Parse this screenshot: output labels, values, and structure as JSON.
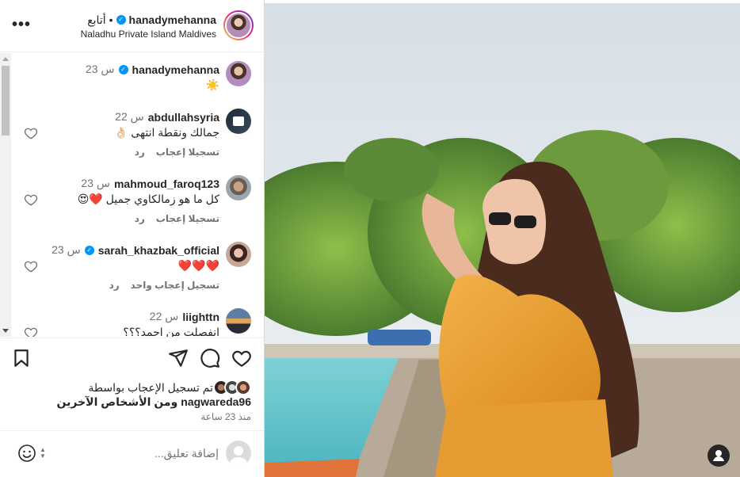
{
  "header": {
    "username": "hanadymehanna",
    "separator": "•",
    "follow_label": "أتابع",
    "location": "Naladhu Private Island Maldives",
    "verified_mark": "✓"
  },
  "caption": {
    "username": "hanadymehanna",
    "time": "23 س",
    "text": "☀️"
  },
  "comments": [
    {
      "username": "abdullahsyria",
      "time": "22 س",
      "text": "جمالك ونقطة انتهى 👌🏻",
      "like_label": "تسجيلا إعجاب",
      "reply_label": "رد"
    },
    {
      "username": "mahmoud_faroq123",
      "time": "23 س",
      "text": "كل ما هو زمالكاوي جميل ❤️😍",
      "like_label": "تسجيلا إعجاب",
      "reply_label": "رد"
    },
    {
      "username": "sarah_khazbak_official",
      "time": "23 س",
      "text": "❤️❤️❤️",
      "like_label": "تسجيل إعجاب واحد",
      "reply_label": "رد"
    },
    {
      "username": "liighttn",
      "time": "22 س",
      "text": "انفصلت من احمد؟؟؟",
      "like_label": "",
      "reply_label": ""
    }
  ],
  "likes": {
    "line1": "تم تسجيل الإعجاب بواسطة",
    "user": "nagwareda96",
    "others": "ومن الأشخاص الآخرين"
  },
  "timeago": "منذ 23 ساعة",
  "add_comment": {
    "placeholder": "إضافة تعليق..."
  },
  "icons": {
    "more": "more-icon",
    "like": "heart-icon",
    "comment": "comment-icon",
    "share": "send-icon",
    "save": "bookmark-icon",
    "emoji": "emoji-icon",
    "tag": "user-tag-icon"
  },
  "colors": {
    "verified": "#0095f6",
    "text": "#262626",
    "secondary": "#737373",
    "heart_red": "#ed4956"
  }
}
